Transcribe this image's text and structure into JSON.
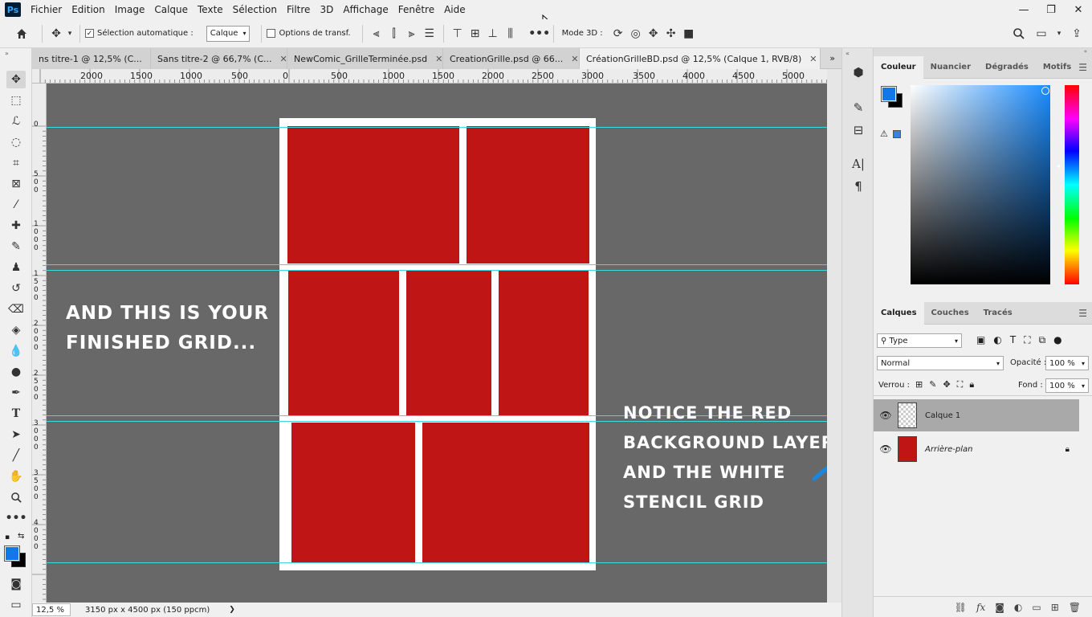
{
  "app": {
    "logo_text": "Ps"
  },
  "menu": [
    "Fichier",
    "Edition",
    "Image",
    "Calque",
    "Texte",
    "Sélection",
    "Filtre",
    "3D",
    "Affichage",
    "Fenêtre",
    "Aide"
  ],
  "window_controls": {
    "minimize": "—",
    "restore": "❐",
    "close": "✕"
  },
  "options": {
    "auto_select_label": "Sélection automatique :",
    "auto_select_checked": true,
    "auto_select_target": "Calque",
    "transform_label": "Options de transf.",
    "more": "•••",
    "mode3d_label": "Mode 3D :"
  },
  "tabs": [
    {
      "label": "ns titre-1 @ 12,5% (C...",
      "active": false
    },
    {
      "label": "Sans titre-2 @ 66,7% (C...",
      "active": false
    },
    {
      "label": "NewComic_GrilleTerminée.psd",
      "active": false
    },
    {
      "label": "CreationGrille.psd @ 66...",
      "active": false
    },
    {
      "label": "CréationGrilleBD.psd @ 12,5% (Calque 1, RVB/8)",
      "active": true
    }
  ],
  "tabs_more": "»",
  "ruler_h": [
    "2000",
    "1500",
    "1000",
    "500",
    "0",
    "500",
    "1000",
    "1500",
    "2000",
    "2500",
    "3000",
    "3500",
    "4000",
    "4500",
    "5000"
  ],
  "ruler_v_marks": [
    "0",
    "5\n0\n0",
    "1\n0\n0\n0",
    "1\n5\n0\n0",
    "2\n0\n0\n0",
    "2\n5\n0\n0",
    "3\n0\n0\n0",
    "3\n5\n0\n0",
    "4\n0\n0\n0"
  ],
  "canvas": {
    "caption_left": [
      "AND THIS IS YOUR",
      "FINISHED GRID..."
    ],
    "caption_right": [
      "NOTICE THE RED",
      "BACKGROUND LAYER",
      "AND THE WHITE",
      "STENCIL GRID"
    ],
    "panel_color": "#c01515",
    "arrow_color": "#1a86e0"
  },
  "status": {
    "zoom": "12,5 %",
    "doc_info": "3150 px x 4500 px (150 ppcm)",
    "arrow": "❯"
  },
  "color_panel": {
    "tabs": [
      "Couleur",
      "Nuancier",
      "Dégradés",
      "Motifs"
    ],
    "foreground": "#1278e8",
    "background": "#000000"
  },
  "layers_panel": {
    "tabs": [
      "Calques",
      "Couches",
      "Tracés"
    ],
    "filter_label": "Type",
    "blend_mode": "Normal",
    "opacity_label": "Opacité :",
    "opacity_value": "100 %",
    "lock_label": "Verrou :",
    "fill_label": "Fond :",
    "fill_value": "100 %",
    "layers": [
      {
        "name": "Calque 1",
        "selected": true,
        "italic": false
      },
      {
        "name": "Arrière-plan",
        "selected": false,
        "italic": true
      }
    ]
  }
}
